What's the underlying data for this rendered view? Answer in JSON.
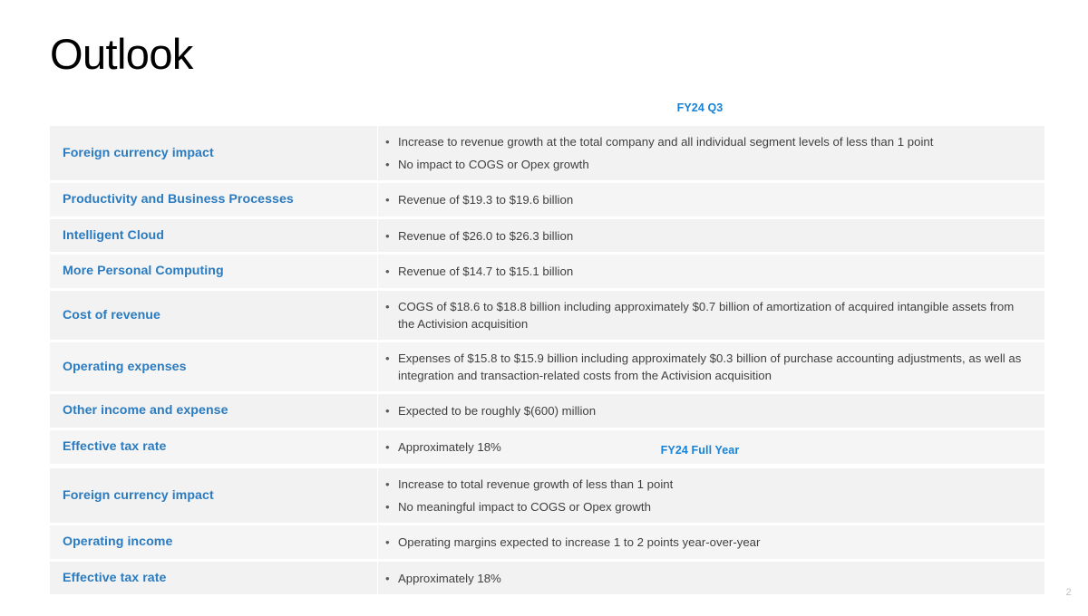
{
  "slide": {
    "title": "Outlook",
    "page_number": "2",
    "accent_color": "#1683D8",
    "label_color": "#2A7BC0",
    "body_color": "#3F3F3F",
    "row_fill": "#F2F2F2",
    "background": "#FFFFFF",
    "bullet_glyph": "•"
  },
  "tables": [
    {
      "caption": "FY24 Q3",
      "rows": [
        {
          "label": "Foreign currency impact",
          "bullets": [
            "Increase to revenue growth at the total company and all individual segment levels of less than 1 point",
            "No impact to COGS or Opex growth"
          ]
        },
        {
          "label": "Productivity and Business Processes",
          "bullets": [
            "Revenue of $19.3 to $19.6 billion"
          ]
        },
        {
          "label": "Intelligent Cloud",
          "bullets": [
            "Revenue of $26.0 to $26.3 billion"
          ]
        },
        {
          "label": "More Personal Computing",
          "bullets": [
            "Revenue of $14.7 to $15.1 billion"
          ]
        },
        {
          "label": "Cost of revenue",
          "bullets": [
            "COGS of $18.6 to $18.8 billion including approximately $0.7 billion of amortization of acquired intangible assets from the Activision acquisition"
          ]
        },
        {
          "label": "Operating expenses",
          "bullets": [
            "Expenses of $15.8 to $15.9 billion including approximately $0.3 billion of purchase accounting adjustments, as well as integration and transaction-related costs from the Activision acquisition"
          ]
        },
        {
          "label": "Other income and expense",
          "bullets": [
            "Expected to be roughly $(600) million"
          ]
        },
        {
          "label": "Effective tax rate",
          "bullets": [
            "Approximately 18%"
          ]
        }
      ]
    },
    {
      "caption": "FY24 Full Year",
      "rows": [
        {
          "label": "Foreign currency impact",
          "bullets": [
            "Increase to total revenue growth of less than 1 point",
            "No meaningful impact to COGS or Opex growth"
          ]
        },
        {
          "label": "Operating income",
          "bullets": [
            "Operating margins expected to increase 1 to 2 points year-over-year"
          ]
        },
        {
          "label": "Effective tax rate",
          "bullets": [
            "Approximately 18%"
          ]
        }
      ]
    }
  ]
}
